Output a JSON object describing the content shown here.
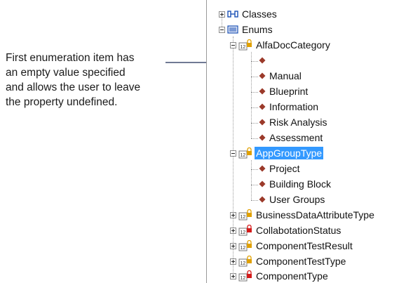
{
  "annotation": {
    "lines": [
      "First enumeration item has",
      "an empty value specified",
      "and allows the user to leave",
      "the property undefined."
    ]
  },
  "tree": {
    "classes": "Classes",
    "enums": "Enums",
    "alfa_doc_category": {
      "label": "AlfaDocCategory",
      "items": [
        "",
        "Manual",
        "Blueprint",
        "Information",
        "Risk Analysis",
        "Assessment"
      ]
    },
    "app_group_type": {
      "label": "AppGroupType",
      "items": [
        "Project",
        "Building Block",
        "User Groups"
      ]
    },
    "more_enums": [
      "BusinessDataAttributeType",
      "CollabotationStatus",
      "ComponentTestResult",
      "ComponentTestType",
      "ComponentType"
    ]
  },
  "colors": {
    "selection": "#3399ff",
    "diamond": "#9b3a2a",
    "lock_red": "#d41a1a",
    "lock_gold": "#e0a000",
    "classes_icon": "#1a4fb5"
  }
}
